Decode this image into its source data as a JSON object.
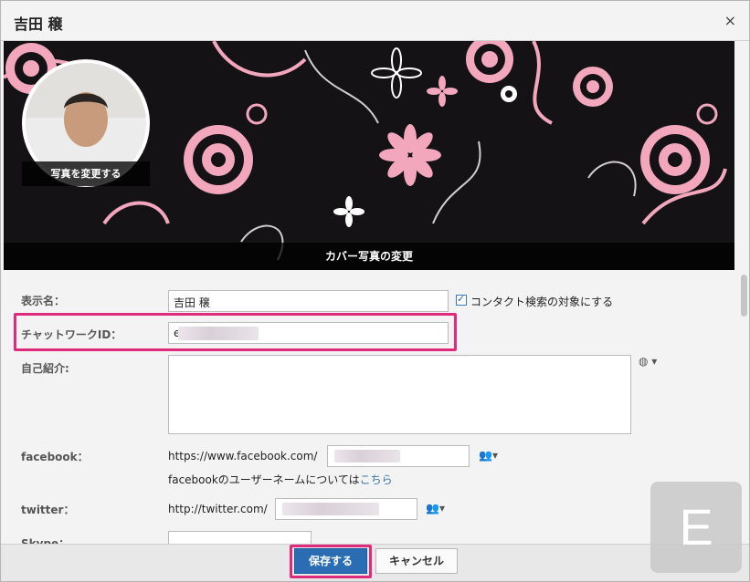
{
  "dialog": {
    "title": "吉田 穣",
    "close_label": "×"
  },
  "cover": {
    "change_cover_label": "カバー写真の変更",
    "change_photo_label": "写真を変更する"
  },
  "form": {
    "display_name": {
      "label": "表示名：",
      "value": "吉田 穣"
    },
    "contact_search": {
      "label": "コンタクト検索の対象にする",
      "checked": true
    },
    "chatwork_id": {
      "label": "チャットワークID：",
      "value_prefix": "e"
    },
    "self_intro": {
      "label": "自己紹介:"
    },
    "facebook": {
      "label": "facebook：",
      "prefix": "https://www.facebook.com/",
      "help_text": "facebookのユーザーネームについては",
      "help_link": "こちら"
    },
    "twitter": {
      "label": "twitter：",
      "prefix": "http://twitter.com/"
    },
    "skype": {
      "label": "Skype："
    }
  },
  "footer": {
    "save_label": "保存する",
    "cancel_label": "キャンセル"
  },
  "badge": {
    "letter": "E"
  },
  "colors": {
    "accent": "#2a6db3",
    "highlight": "#e02b7d",
    "cover_pink": "#f4a9bf"
  }
}
